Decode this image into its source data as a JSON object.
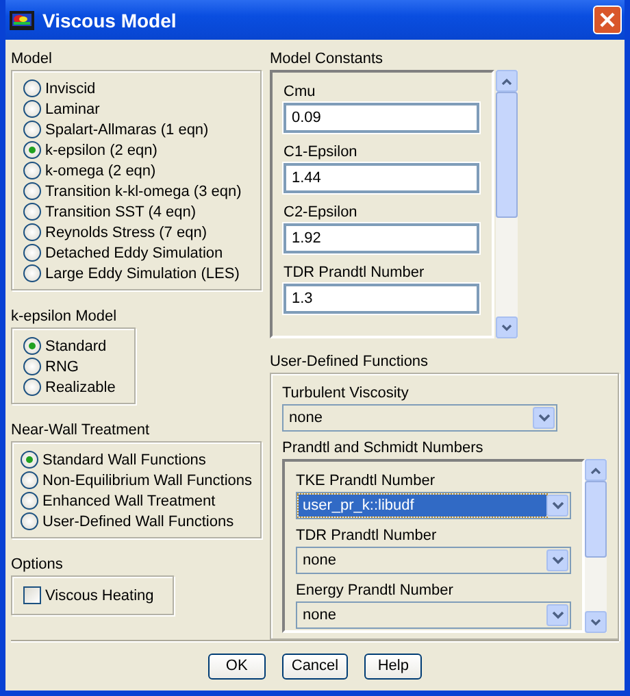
{
  "window": {
    "title": "Viscous Model"
  },
  "model": {
    "label": "Model",
    "options": [
      {
        "label": "Inviscid",
        "selected": false
      },
      {
        "label": "Laminar",
        "selected": false
      },
      {
        "label": "Spalart-Allmaras (1 eqn)",
        "selected": false
      },
      {
        "label": "k-epsilon (2 eqn)",
        "selected": true
      },
      {
        "label": "k-omega (2 eqn)",
        "selected": false
      },
      {
        "label": "Transition k-kl-omega (3 eqn)",
        "selected": false
      },
      {
        "label": "Transition SST (4 eqn)",
        "selected": false
      },
      {
        "label": "Reynolds Stress (7 eqn)",
        "selected": false
      },
      {
        "label": "Detached Eddy Simulation",
        "selected": false
      },
      {
        "label": "Large Eddy Simulation (LES)",
        "selected": false
      }
    ]
  },
  "k_epsilon_model": {
    "label": "k-epsilon Model",
    "options": [
      {
        "label": "Standard",
        "selected": true
      },
      {
        "label": "RNG",
        "selected": false
      },
      {
        "label": "Realizable",
        "selected": false
      }
    ]
  },
  "near_wall_treatment": {
    "label": "Near-Wall Treatment",
    "options": [
      {
        "label": "Standard Wall Functions",
        "selected": true
      },
      {
        "label": "Non-Equilibrium Wall Functions",
        "selected": false
      },
      {
        "label": "Enhanced Wall Treatment",
        "selected": false
      },
      {
        "label": "User-Defined Wall Functions",
        "selected": false
      }
    ]
  },
  "options": {
    "label": "Options",
    "checkboxes": [
      {
        "label": "Viscous Heating",
        "checked": false
      }
    ]
  },
  "model_constants": {
    "label": "Model Constants",
    "fields": [
      {
        "label": "Cmu",
        "value": "0.09"
      },
      {
        "label": "C1-Epsilon",
        "value": "1.44"
      },
      {
        "label": "C2-Epsilon",
        "value": "1.92"
      },
      {
        "label": "TDR Prandtl Number",
        "value": "1.3"
      }
    ]
  },
  "user_defined_functions": {
    "label": "User-Defined Functions",
    "turbulent_viscosity": {
      "label": "Turbulent Viscosity",
      "value": "none"
    },
    "prandtl_and_schmidt": {
      "label": "Prandtl and Schmidt Numbers",
      "fields": [
        {
          "label": "TKE Prandtl Number",
          "value": "user_pr_k::libudf",
          "selected": true
        },
        {
          "label": "TDR Prandtl Number",
          "value": "none",
          "selected": false
        },
        {
          "label": "Energy Prandtl Number",
          "value": "none",
          "selected": false
        }
      ]
    }
  },
  "buttons": [
    "OK",
    "Cancel",
    "Help"
  ]
}
